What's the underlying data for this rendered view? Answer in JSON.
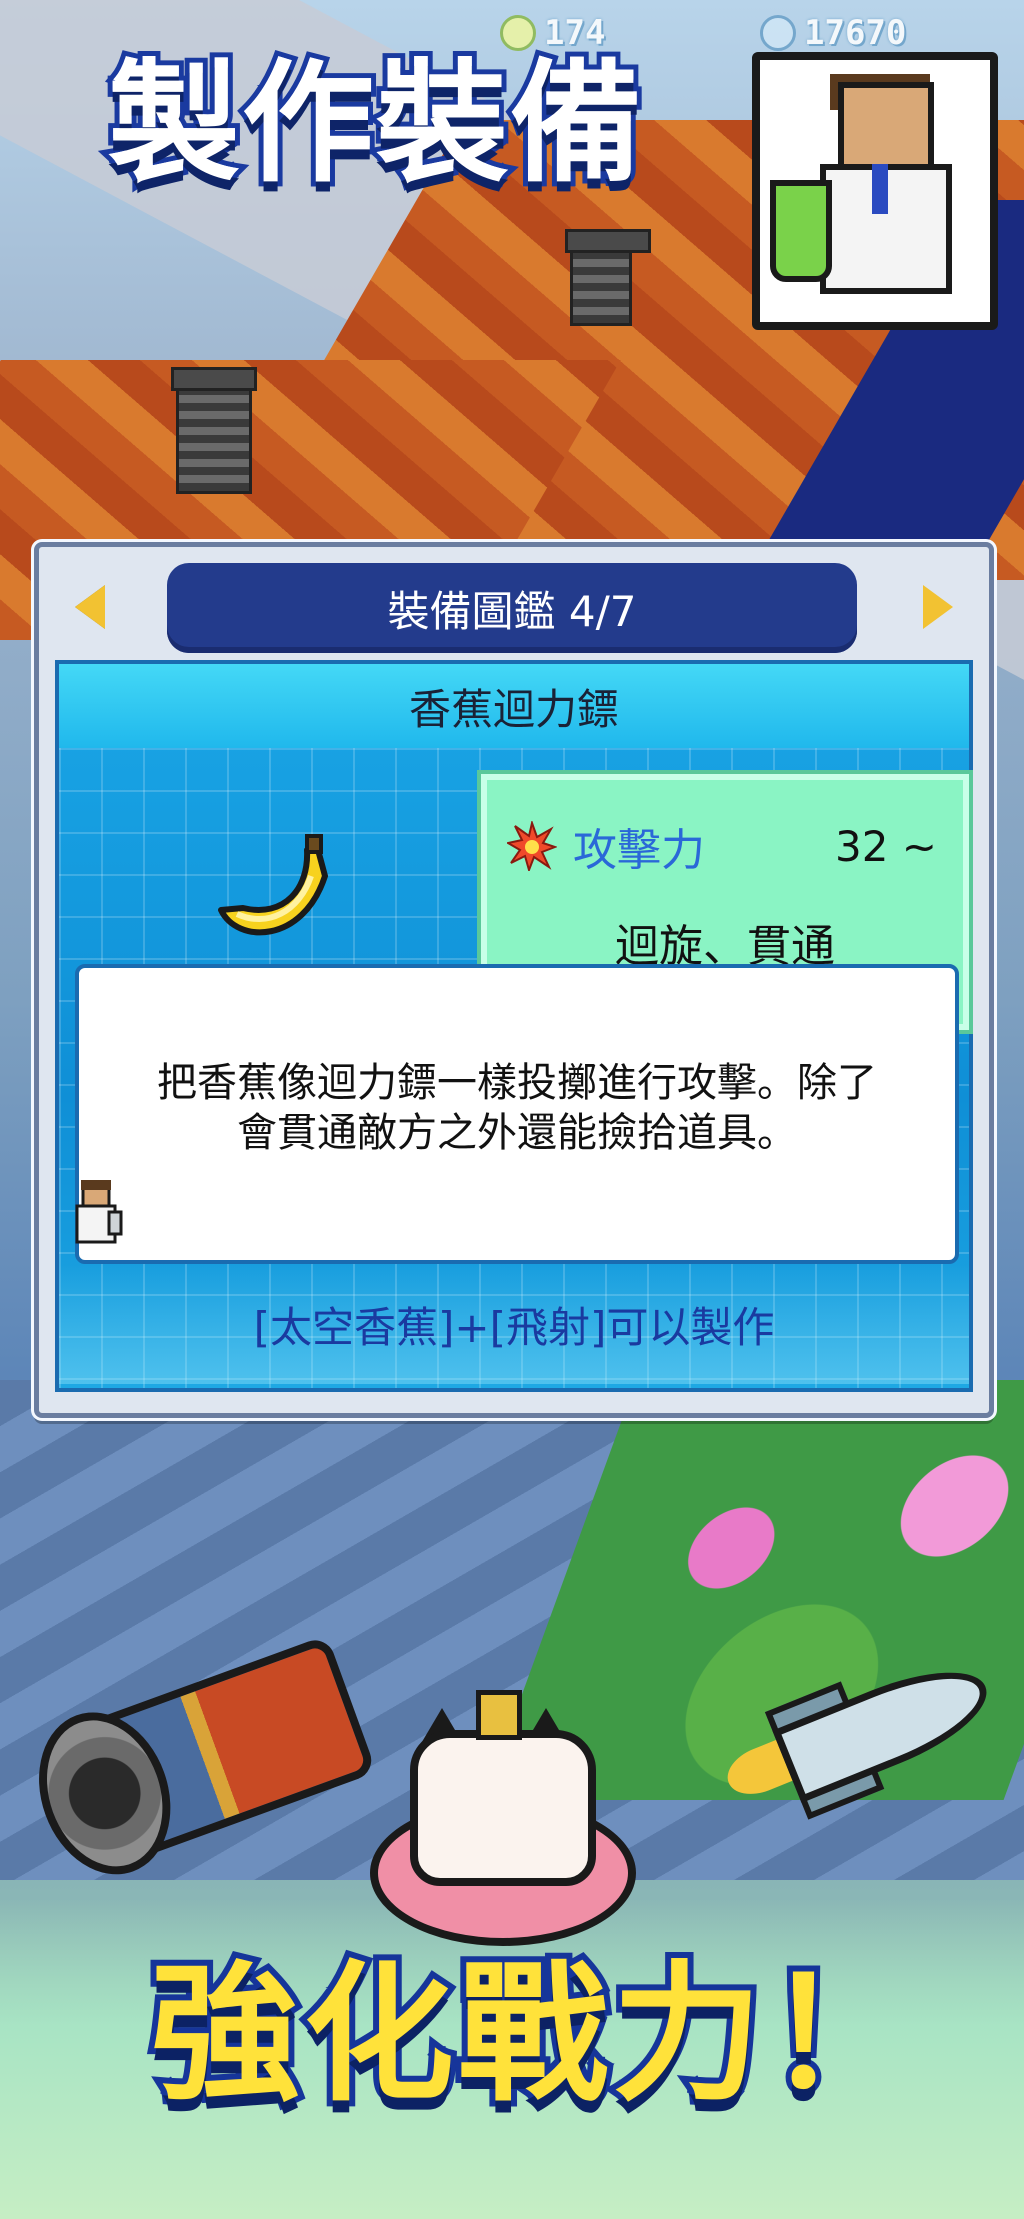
{
  "hud": {
    "left_value": "174",
    "right_value": "17670"
  },
  "titles": {
    "top": "製作裝備",
    "bottom": "強化戰力！"
  },
  "catalog": {
    "header": "裝備圖鑑 4/7",
    "item_name": "香蕉迴力鏢",
    "stats": {
      "label": "攻擊力",
      "value": "32 ~",
      "effect": "迴旋、貫通"
    },
    "description_line1": "把香蕉像迴力鏢一樣投擲進行攻擊。除了",
    "description_line2": "會貫通敵方之外還能撿拾道具。",
    "recipe": "[太空香蕉]+[飛射]可以製作"
  },
  "colors": {
    "title_outline": "#1a3aa0",
    "title_bottom_fill": "#ffe23a",
    "panel_header": "#233b8c",
    "stat_card": "#8af4c4",
    "stat_label": "#2a68d8",
    "arrows": "#f2c232"
  },
  "icons": [
    "banana-icon",
    "attack-burst-icon",
    "arrow-left-icon",
    "arrow-right-icon"
  ]
}
